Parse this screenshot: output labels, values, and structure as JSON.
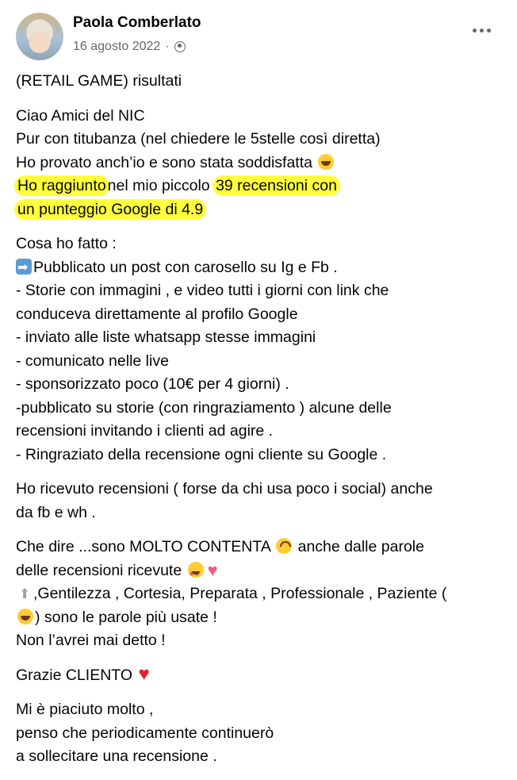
{
  "post": {
    "author": "Paola Comberlato",
    "date": "16 agosto 2022",
    "separator": "·",
    "privacy_icon": "globe-icon",
    "more_icon": "more-options-icon"
  },
  "content": {
    "title": "(RETAIL GAME) risultati",
    "p1": {
      "l1": "Ciao Amici del NIC",
      "l2": "Pur con titubanza (nel chiedere le 5stelle così diretta)",
      "l3": "Ho provato anch’io e sono stata soddisfatta",
      "l4_hl1": "Ho raggiunto",
      "l4_mid": "nel mio piccolo",
      "l4_hl2": "39 recensioni con",
      "l5_hl": "un punteggio Google di 4.9"
    },
    "p2": {
      "l1": "Cosa ho fatto :",
      "l2": "Pubblicato un post con carosello su Ig e Fb .",
      "l3": "- Storie con immagini , e video  tutti i giorni con link che",
      "l4": "conduceva direttamente al profilo Google",
      "l5": "- inviato alle liste whatsapp stesse immagini",
      "l6": "- comunicato nelle live",
      "l7": "- sponsorizzato poco (10€ per 4 giorni) .",
      "l8": "-pubblicato su storie (con ringraziamento ) alcune delle",
      "l9": "recensioni invitando i clienti ad agire .",
      "l10": "- Ringraziato della recensione ogni cliente su Google ."
    },
    "p3": {
      "l1": "Ho ricevuto recensioni ( forse da chi usa poco i social) anche",
      "l2": "da fb e wh ."
    },
    "p4": {
      "l1a": "Che dire ...sono MOLTO CONTENTA",
      "l1b": "anche dalle parole",
      "l2": "delle recensioni ricevute",
      "l3": ",Gentilezza , Cortesia, Preparata , Professionale , Paziente (",
      "l4": ") sono le parole più usate !",
      "l5": "Non l’avrei mai detto !"
    },
    "p5": {
      "l1": "Grazie CLIENTO"
    },
    "p6": {
      "l1": "Mi è piaciuto molto ,",
      "l2": "penso che periodicamente continuerò",
      "l3": "a sollecitare una recensione  ."
    }
  },
  "colors": {
    "highlight": "#ffff3d",
    "secondary_text": "#65676b",
    "text": "#050505"
  }
}
